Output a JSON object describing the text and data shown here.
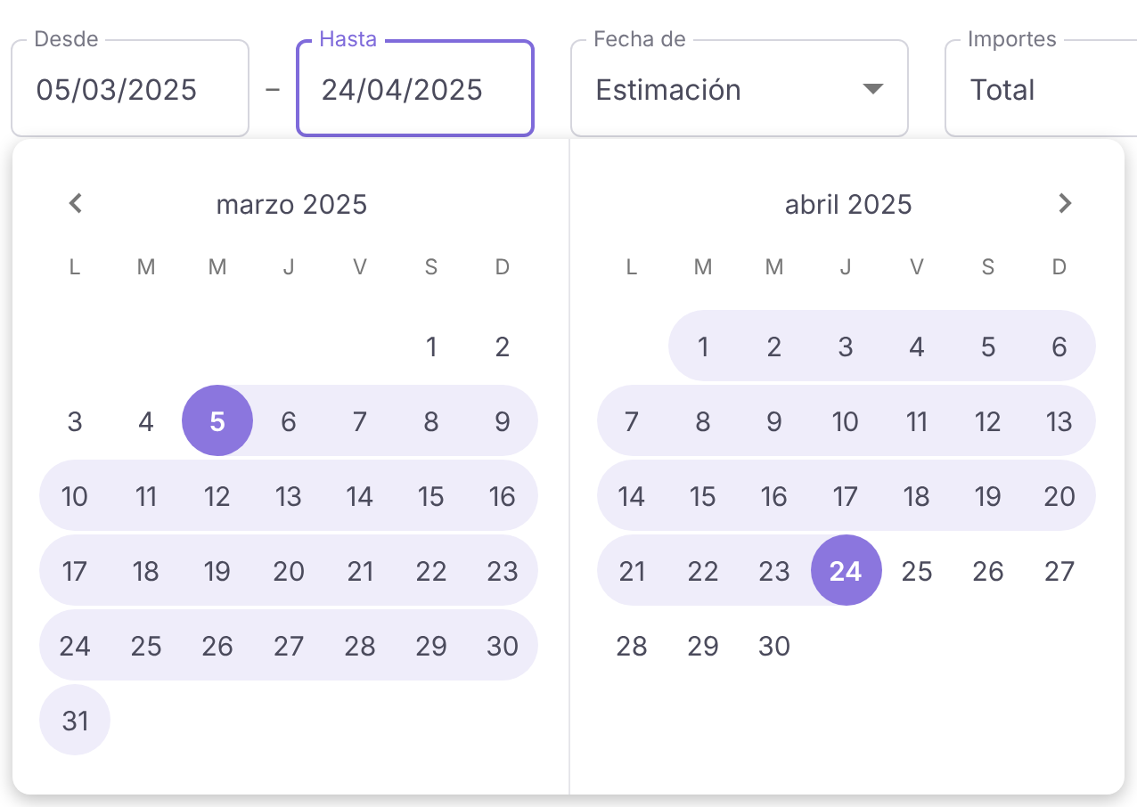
{
  "filters": [
    {
      "kind": "date",
      "label": "Desde",
      "value": "05/03/2025",
      "focused": false
    },
    {
      "kind": "separator",
      "text": "–"
    },
    {
      "kind": "date",
      "label": "Hasta",
      "value": "24/04/2025",
      "focused": true
    },
    {
      "kind": "select",
      "label": "Fecha de",
      "value": "Estimación",
      "focused": false
    },
    {
      "kind": "select_plain",
      "label": "Importes",
      "value": "Total",
      "focused": false
    }
  ],
  "calendar": {
    "months": [
      {
        "title": "marzo 2025",
        "prev_button": true,
        "next_button": false,
        "weekdays": [
          "L",
          "M",
          "M",
          "J",
          "V",
          "S",
          "D"
        ],
        "weeks": [
          [
            {
              "kind": "blank"
            },
            {
              "kind": "blank"
            },
            {
              "kind": "blank"
            },
            {
              "kind": "blank"
            },
            {
              "kind": "blank"
            },
            {
              "kind": "day",
              "day": "1",
              "in_range": false,
              "selected": false
            },
            {
              "kind": "day",
              "day": "2",
              "in_range": false,
              "selected": false
            }
          ],
          [
            {
              "kind": "day",
              "day": "3",
              "in_range": false,
              "selected": false
            },
            {
              "kind": "day",
              "day": "4",
              "in_range": false,
              "selected": false
            },
            {
              "kind": "day",
              "day": "5",
              "in_range": true,
              "selected": true
            },
            {
              "kind": "day",
              "day": "6",
              "in_range": true,
              "selected": false
            },
            {
              "kind": "day",
              "day": "7",
              "in_range": true,
              "selected": false
            },
            {
              "kind": "day",
              "day": "8",
              "in_range": true,
              "selected": false
            },
            {
              "kind": "day",
              "day": "9",
              "in_range": true,
              "selected": false
            }
          ],
          [
            {
              "kind": "day",
              "day": "10",
              "in_range": true,
              "selected": false
            },
            {
              "kind": "day",
              "day": "11",
              "in_range": true,
              "selected": false
            },
            {
              "kind": "day",
              "day": "12",
              "in_range": true,
              "selected": false
            },
            {
              "kind": "day",
              "day": "13",
              "in_range": true,
              "selected": false
            },
            {
              "kind": "day",
              "day": "14",
              "in_range": true,
              "selected": false
            },
            {
              "kind": "day",
              "day": "15",
              "in_range": true,
              "selected": false
            },
            {
              "kind": "day",
              "day": "16",
              "in_range": true,
              "selected": false
            }
          ],
          [
            {
              "kind": "day",
              "day": "17",
              "in_range": true,
              "selected": false
            },
            {
              "kind": "day",
              "day": "18",
              "in_range": true,
              "selected": false
            },
            {
              "kind": "day",
              "day": "19",
              "in_range": true,
              "selected": false
            },
            {
              "kind": "day",
              "day": "20",
              "in_range": true,
              "selected": false
            },
            {
              "kind": "day",
              "day": "21",
              "in_range": true,
              "selected": false
            },
            {
              "kind": "day",
              "day": "22",
              "in_range": true,
              "selected": false
            },
            {
              "kind": "day",
              "day": "23",
              "in_range": true,
              "selected": false
            }
          ],
          [
            {
              "kind": "day",
              "day": "24",
              "in_range": true,
              "selected": false
            },
            {
              "kind": "day",
              "day": "25",
              "in_range": true,
              "selected": false
            },
            {
              "kind": "day",
              "day": "26",
              "in_range": true,
              "selected": false
            },
            {
              "kind": "day",
              "day": "27",
              "in_range": true,
              "selected": false
            },
            {
              "kind": "day",
              "day": "28",
              "in_range": true,
              "selected": false
            },
            {
              "kind": "day",
              "day": "29",
              "in_range": true,
              "selected": false
            },
            {
              "kind": "day",
              "day": "30",
              "in_range": true,
              "selected": false
            }
          ],
          [
            {
              "kind": "day",
              "day": "31",
              "in_range": true,
              "selected": false
            }
          ]
        ]
      },
      {
        "title": "abril 2025",
        "prev_button": false,
        "next_button": true,
        "weekdays": [
          "L",
          "M",
          "M",
          "J",
          "V",
          "S",
          "D"
        ],
        "weeks": [
          [
            {
              "kind": "blank"
            },
            {
              "kind": "day",
              "day": "1",
              "in_range": true,
              "selected": false
            },
            {
              "kind": "day",
              "day": "2",
              "in_range": true,
              "selected": false
            },
            {
              "kind": "day",
              "day": "3",
              "in_range": true,
              "selected": false
            },
            {
              "kind": "day",
              "day": "4",
              "in_range": true,
              "selected": false
            },
            {
              "kind": "day",
              "day": "5",
              "in_range": true,
              "selected": false
            },
            {
              "kind": "day",
              "day": "6",
              "in_range": true,
              "selected": false
            }
          ],
          [
            {
              "kind": "day",
              "day": "7",
              "in_range": true,
              "selected": false
            },
            {
              "kind": "day",
              "day": "8",
              "in_range": true,
              "selected": false
            },
            {
              "kind": "day",
              "day": "9",
              "in_range": true,
              "selected": false
            },
            {
              "kind": "day",
              "day": "10",
              "in_range": true,
              "selected": false
            },
            {
              "kind": "day",
              "day": "11",
              "in_range": true,
              "selected": false
            },
            {
              "kind": "day",
              "day": "12",
              "in_range": true,
              "selected": false
            },
            {
              "kind": "day",
              "day": "13",
              "in_range": true,
              "selected": false
            }
          ],
          [
            {
              "kind": "day",
              "day": "14",
              "in_range": true,
              "selected": false
            },
            {
              "kind": "day",
              "day": "15",
              "in_range": true,
              "selected": false
            },
            {
              "kind": "day",
              "day": "16",
              "in_range": true,
              "selected": false
            },
            {
              "kind": "day",
              "day": "17",
              "in_range": true,
              "selected": false
            },
            {
              "kind": "day",
              "day": "18",
              "in_range": true,
              "selected": false
            },
            {
              "kind": "day",
              "day": "19",
              "in_range": true,
              "selected": false
            },
            {
              "kind": "day",
              "day": "20",
              "in_range": true,
              "selected": false
            }
          ],
          [
            {
              "kind": "day",
              "day": "21",
              "in_range": true,
              "selected": false
            },
            {
              "kind": "day",
              "day": "22",
              "in_range": true,
              "selected": false
            },
            {
              "kind": "day",
              "day": "23",
              "in_range": true,
              "selected": false
            },
            {
              "kind": "day",
              "day": "24",
              "in_range": true,
              "selected": true
            },
            {
              "kind": "day",
              "day": "25",
              "in_range": false,
              "selected": false
            },
            {
              "kind": "day",
              "day": "26",
              "in_range": false,
              "selected": false
            },
            {
              "kind": "day",
              "day": "27",
              "in_range": false,
              "selected": false
            }
          ],
          [
            {
              "kind": "day",
              "day": "28",
              "in_range": false,
              "selected": false
            },
            {
              "kind": "day",
              "day": "29",
              "in_range": false,
              "selected": false
            },
            {
              "kind": "day",
              "day": "30",
              "in_range": false,
              "selected": false
            }
          ]
        ]
      }
    ]
  }
}
